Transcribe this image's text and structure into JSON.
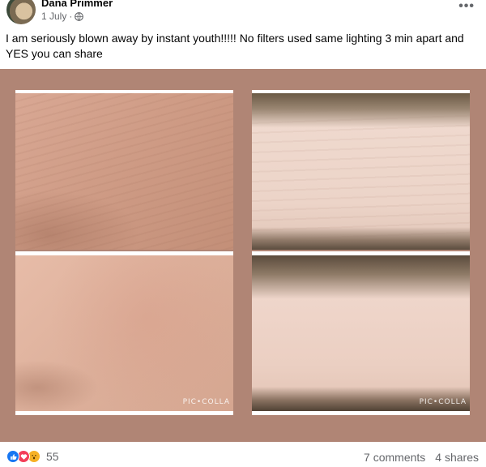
{
  "post": {
    "author": "Dana Primmer",
    "date": "1 July",
    "separator": "·",
    "privacy_icon": "globe-icon",
    "more_icon": "more-horizontal-icon",
    "more_label": "•••",
    "text": "I am seriously blown away by instant youth!!!!! No filters used same lighting 3 min apart and YES you can share"
  },
  "photo": {
    "background_color": "#b08575",
    "watermarks": [
      "PIC•COLLA",
      "PIC•COLLA"
    ]
  },
  "footer": {
    "reaction_icons": [
      "like-icon",
      "love-icon",
      "wow-icon"
    ],
    "reaction_count": "55",
    "comments": "7 comments",
    "shares": "4 shares"
  },
  "colors": {
    "like": "#1877f2",
    "love": "#f33e58",
    "wow": "#f7b125",
    "secondary_text": "#65676b"
  }
}
